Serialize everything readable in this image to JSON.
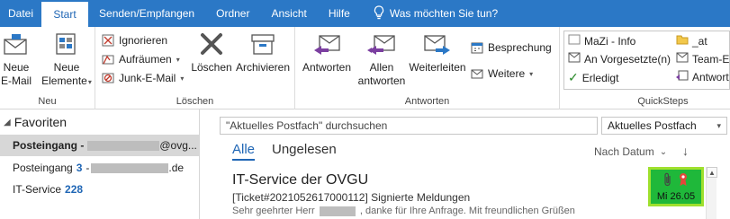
{
  "menu": {
    "tabs": [
      "Datei",
      "Start",
      "Senden/Empfangen",
      "Ordner",
      "Ansicht",
      "Hilfe"
    ],
    "active": "Start",
    "tell_me": "Was möchten Sie tun?"
  },
  "ribbon": {
    "neu": {
      "label": "Neu",
      "new_email": [
        "Neue",
        "E-Mail"
      ],
      "new_items": [
        "Neue",
        "Elemente"
      ]
    },
    "loeschen": {
      "label": "Löschen",
      "ignore": "Ignorieren",
      "cleanup": "Aufräumen",
      "junk": "Junk-E-Mail",
      "delete": "Löschen",
      "archive": "Archivieren"
    },
    "antworten": {
      "label": "Antworten",
      "reply": "Antworten",
      "reply_all": [
        "Allen",
        "antworten"
      ],
      "forward": "Weiterleiten",
      "meeting": "Besprechung",
      "more": "Weitere"
    },
    "quicksteps": {
      "label": "QuickSteps",
      "items": [
        "MaZi - Info",
        "An Vorgesetzte(n)",
        "Erledigt",
        "_at",
        "Team-E",
        "Antwort"
      ]
    }
  },
  "nav": {
    "favorites": "Favoriten",
    "folders": [
      {
        "name": "Posteingang -",
        "suffix": "@ovg...",
        "count": "",
        "selected": true
      },
      {
        "name": "Posteingang",
        "count": "3",
        "prefix": "-",
        "suffix": ".de",
        "selected": false
      },
      {
        "name": "IT-Service",
        "count": "228",
        "selected": false
      }
    ]
  },
  "list": {
    "search_placeholder": "\"Aktuelles Postfach\" durchsuchen",
    "scope": "Aktuelles Postfach",
    "tabs": {
      "all": "Alle",
      "unread": "Ungelesen"
    },
    "sort": "Nach Datum",
    "sort_dir": "↓",
    "mail": {
      "sender": "IT-Service der OVGU",
      "subject": "[Ticket#2021052617000112] Signierte Meldungen",
      "preview_a": "Sehr geehrter Herr",
      "preview_b": ",  danke für Ihre Anfrage.  Mit freundlichen Grüßen",
      "date": "Mi 26.05"
    }
  },
  "colors": {
    "brand": "#2b78c6",
    "accent": "#1f66b5",
    "highlight": "#1fb83a"
  }
}
